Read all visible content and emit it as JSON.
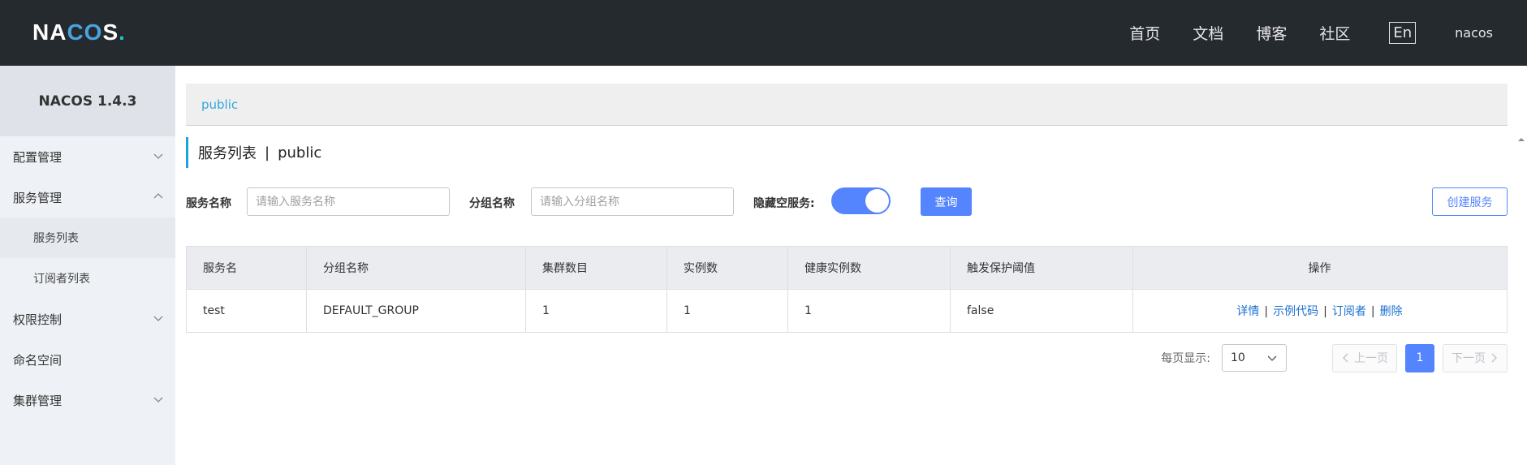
{
  "header": {
    "logo": {
      "prefix": "NA",
      "co": "CO",
      "suffix": "S",
      "dot": "."
    },
    "nav": [
      "首页",
      "文档",
      "博客",
      "社区"
    ],
    "lang": "En",
    "user": "nacos"
  },
  "sidebar": {
    "title": "NACOS 1.4.3",
    "items": [
      {
        "label": "配置管理"
      },
      {
        "label": "服务管理"
      },
      {
        "label": "服务列表"
      },
      {
        "label": "订阅者列表"
      },
      {
        "label": "权限控制"
      },
      {
        "label": "命名空间"
      },
      {
        "label": "集群管理"
      }
    ]
  },
  "main": {
    "namespace": "public",
    "title": "服务列表",
    "title_sep": "|",
    "title_ns": "public",
    "filters": {
      "service_label": "服务名称",
      "service_placeholder": "请输入服务名称",
      "group_label": "分组名称",
      "group_placeholder": "请输入分组名称",
      "hide_empty_label": "隐藏空服务:",
      "hide_empty_on": true,
      "query_btn": "查询",
      "create_btn": "创建服务"
    },
    "table": {
      "headers": [
        "服务名",
        "分组名称",
        "集群数目",
        "实例数",
        "健康实例数",
        "触发保护阈值",
        "操作"
      ],
      "rows": [
        {
          "name": "test",
          "group": "DEFAULT_GROUP",
          "clusters": "1",
          "instances": "1",
          "healthy": "1",
          "threshold": "false"
        }
      ],
      "ops": [
        "详情",
        "示例代码",
        "订阅者",
        "删除"
      ],
      "op_sep": "|"
    },
    "pagination": {
      "page_size_label": "每页显示:",
      "page_size": "10",
      "prev": "上一页",
      "current": "1",
      "next": "下一页"
    }
  },
  "colors": {
    "header_bg": "#252a2f",
    "primary": "#5584ff",
    "accent": "#1aa3d8",
    "link": "#1a6fd1"
  }
}
